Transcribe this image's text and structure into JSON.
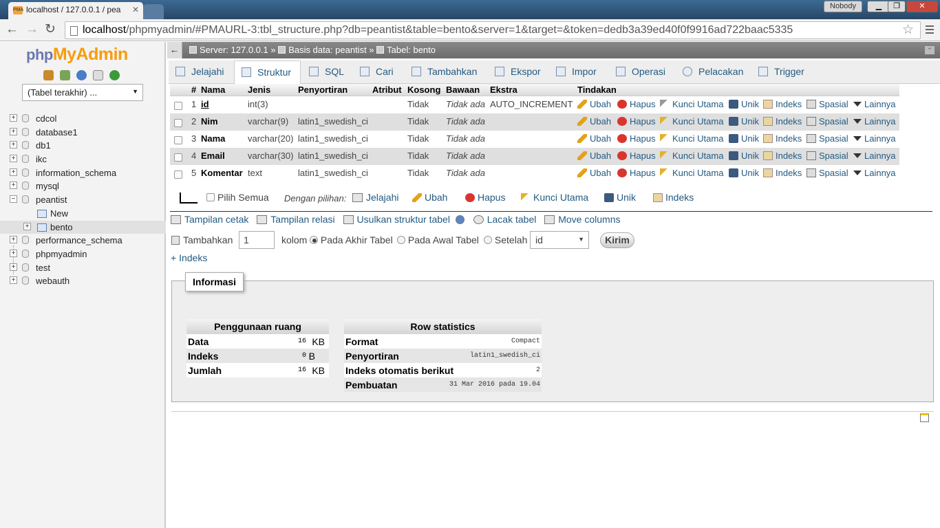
{
  "browser": {
    "tab_title": "localhost / 127.0.0.1 / pea",
    "user_label": "Nobody",
    "url_host": "localhost",
    "url_rest": "/phpmyadmin/#PMAURL-3:tbl_structure.php?db=peantist&table=bento&server=1&target=&token=dedb3a39ed40f0f9916ad722baac5335"
  },
  "sidebar": {
    "logo_php": "php",
    "logo_my": "MyAdmin",
    "recent_select": "(Tabel terakhir) ...",
    "databases": [
      {
        "name": "cdcol"
      },
      {
        "name": "database1"
      },
      {
        "name": "db1"
      },
      {
        "name": "ikc"
      },
      {
        "name": "information_schema"
      },
      {
        "name": "mysql"
      },
      {
        "name": "peantist",
        "expanded": true
      },
      {
        "name": "performance_schema"
      },
      {
        "name": "phpmyadmin"
      },
      {
        "name": "test"
      },
      {
        "name": "webauth"
      }
    ],
    "subitems": [
      "New",
      "bento"
    ]
  },
  "breadcrumb": {
    "server": "Server: 127.0.0.1",
    "db": "Basis data: peantist",
    "table": "Tabel: bento",
    "sep": "»"
  },
  "tabs": [
    "Jelajahi",
    "Struktur",
    "SQL",
    "Cari",
    "Tambahkan",
    "Ekspor",
    "Impor",
    "Operasi",
    "Pelacakan",
    "Trigger"
  ],
  "structure": {
    "headers": {
      "num": "#",
      "name": "Nama",
      "type": "Jenis",
      "collation": "Penyortiran",
      "attr": "Atribut",
      "null": "Kosong",
      "default": "Bawaan",
      "extra": "Ekstra",
      "actions": "Tindakan"
    },
    "rows": [
      {
        "num": "1",
        "name": "id",
        "type": "int(3)",
        "collation": "",
        "null": "Tidak",
        "default": "Tidak ada",
        "extra": "AUTO_INCREMENT"
      },
      {
        "num": "2",
        "name": "Nim",
        "type": "varchar(9)",
        "collation": "latin1_swedish_ci",
        "null": "Tidak",
        "default": "Tidak ada",
        "extra": ""
      },
      {
        "num": "3",
        "name": "Nama",
        "type": "varchar(20)",
        "collation": "latin1_swedish_ci",
        "null": "Tidak",
        "default": "Tidak ada",
        "extra": ""
      },
      {
        "num": "4",
        "name": "Email",
        "type": "varchar(30)",
        "collation": "latin1_swedish_ci",
        "null": "Tidak",
        "default": "Tidak ada",
        "extra": ""
      },
      {
        "num": "5",
        "name": "Komentar",
        "type": "text",
        "collation": "latin1_swedish_ci",
        "null": "Tidak",
        "default": "Tidak ada",
        "extra": ""
      }
    ],
    "actions": {
      "edit": "Ubah",
      "drop": "Hapus",
      "primary": "Kunci Utama",
      "unique": "Unik",
      "index": "Indeks",
      "spatial": "Spasial",
      "more": "Lainnya"
    }
  },
  "bulk": {
    "check_all": "Pilih Semua",
    "with_selected": "Dengan pilihan:",
    "browse": "Jelajahi",
    "edit": "Ubah",
    "drop": "Hapus",
    "primary": "Kunci Utama",
    "unique": "Unik",
    "index": "Indeks"
  },
  "links": {
    "print": "Tampilan cetak",
    "relation": "Tampilan relasi",
    "propose": "Usulkan struktur tabel",
    "track": "Lacak tabel",
    "move": "Move columns"
  },
  "add_columns": {
    "label": "Tambahkan",
    "value": "1",
    "unit": "kolom",
    "opt_end": "Pada Akhir Tabel",
    "opt_begin": "Pada Awal Tabel",
    "opt_after": "Setelah",
    "after_col": "id",
    "submit": "Kirim"
  },
  "add_index": "+ Indeks",
  "info": {
    "legend": "Informasi",
    "space": {
      "title": "Penggunaan ruang",
      "rows": [
        {
          "k": "Data",
          "v": "16",
          "unit": "KB"
        },
        {
          "k": "Indeks",
          "v": "0",
          "unit": "B"
        },
        {
          "k": "Jumlah",
          "v": "16",
          "unit": "KB"
        }
      ]
    },
    "stats": {
      "title": "Row statistics",
      "rows": [
        {
          "k": "Format",
          "v": "Compact"
        },
        {
          "k": "Penyortiran",
          "v": "latin1_swedish_ci"
        },
        {
          "k": "Indeks otomatis berikut",
          "v": "2"
        },
        {
          "k": "Pembuatan",
          "v": "31 Mar 2016 pada 19.04"
        }
      ]
    }
  }
}
